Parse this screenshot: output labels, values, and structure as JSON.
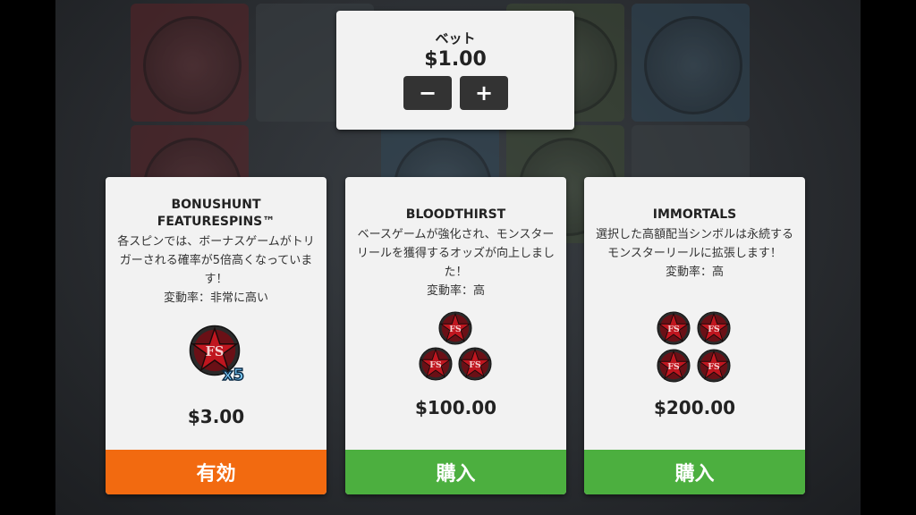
{
  "bet": {
    "label": "ベット",
    "amount": "$1.00",
    "decrease_label": "−",
    "increase_label": "+"
  },
  "cards": [
    {
      "title_line1": "BONUSHUNT",
      "title_line2": "FEATURESPINS™",
      "description": "各スピンでは、ボーナスゲームがトリガーされる確率が5倍高くなっています！",
      "volatility": "変動率：非常に高い",
      "badge_text": "FS",
      "badge_multiplier": "x5",
      "price": "$3.00",
      "action": "有効",
      "action_color": "#f26a10"
    },
    {
      "title_line1": "BLOODTHIRST",
      "description": "ベースゲームが強化され、モンスターリールを獲得するオッズが向上しました！",
      "volatility": "変動率：高",
      "badge_text": "FS",
      "badge_count": 3,
      "price": "$100.00",
      "action": "購入",
      "action_color": "#4caf3f"
    },
    {
      "title_line1": "IMMORTALS",
      "description": "選択した高額配当シンボルは永続するモンスターリールに拡張します！",
      "volatility": "変動率：高",
      "badge_text": "FS",
      "badge_count": 4,
      "price": "$200.00",
      "action": "購入",
      "action_color": "#4caf3f"
    }
  ]
}
